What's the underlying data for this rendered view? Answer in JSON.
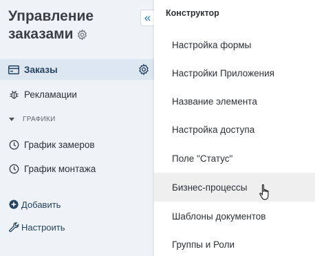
{
  "app": {
    "title_line1": "Управление",
    "title_line2": "заказами"
  },
  "sidebar": {
    "collapse_glyph": "«",
    "nav": [
      {
        "label": "Заказы",
        "icon": "card-icon",
        "active": true
      },
      {
        "label": "Рекламации",
        "icon": "bug-icon",
        "active": false
      }
    ],
    "section": {
      "label": "ГРАФИКИ"
    },
    "charts": [
      {
        "label": "График замеров",
        "icon": "clock-icon"
      },
      {
        "label": "График монтажа",
        "icon": "clock-icon"
      }
    ],
    "actions": {
      "add_label": "Добавить",
      "configure_label": "Настроить"
    }
  },
  "menu": {
    "header": "Конструктор",
    "items": [
      {
        "label": "Настройка формы"
      },
      {
        "label": "Настройки Приложения"
      },
      {
        "label": "Название элемента"
      },
      {
        "label": "Настройка доступа"
      },
      {
        "label": "Поле \"Статус\""
      },
      {
        "label": "Бизнес-процессы",
        "hovered": true
      },
      {
        "label": "Шаблоны документов"
      },
      {
        "label": "Группы и Роли"
      }
    ]
  },
  "colors": {
    "sidebar_bg": "#eef3f8",
    "active_bg": "#dde7f1",
    "accent": "#1a73c8",
    "hover_bg": "#efefef"
  }
}
